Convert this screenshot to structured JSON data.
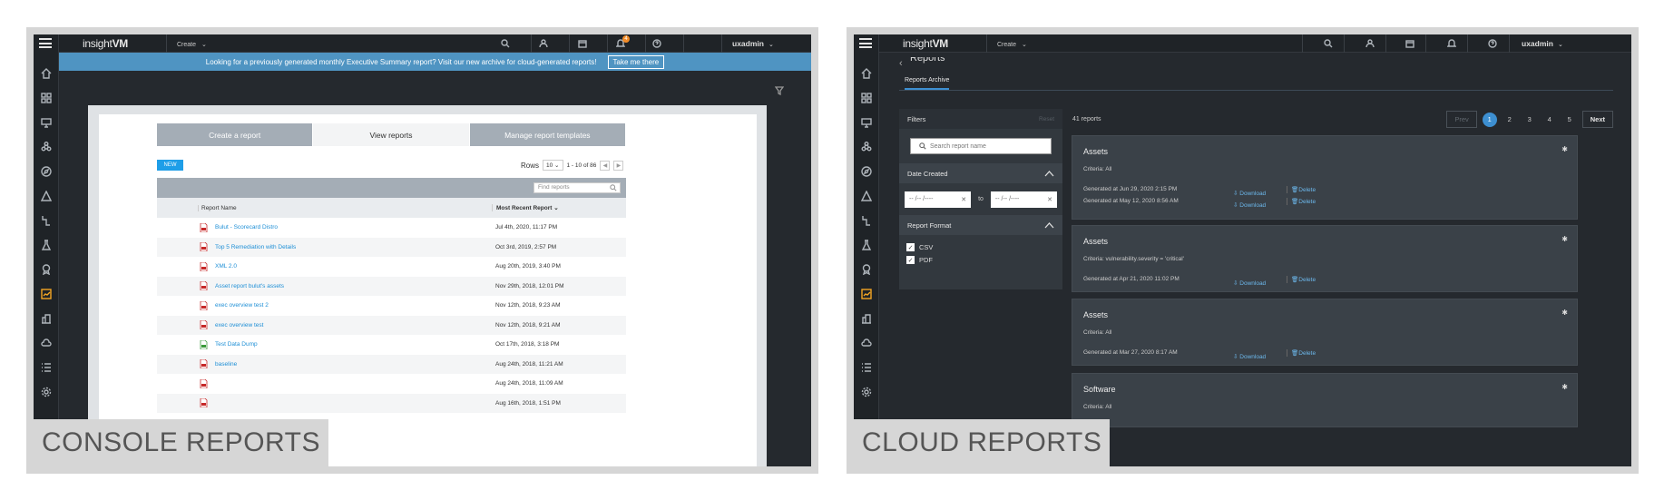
{
  "console": {
    "label": "CONSOLE REPORTS",
    "topbar": {
      "logo": "insightVM",
      "create": "Create",
      "user": "uxadmin",
      "notifications": "4"
    },
    "banner": {
      "text": "Looking for a previously generated monthly Executive Summary report? Visit our new archive for cloud-generated reports!",
      "button": "Take me there"
    },
    "tabs": [
      "Create a report",
      "View reports",
      "Manage report templates"
    ],
    "new_label": "NEW",
    "rows_label": "Rows",
    "rows_value": "10",
    "pagination": "1 - 10 of 86",
    "find_placeholder": "Find reports",
    "columns": {
      "name": "Report Name",
      "recent": "Most Recent Report"
    },
    "reports": [
      {
        "name": "Bulut - Scorecard Distro",
        "date": "Jul 4th, 2020, 11:17 PM",
        "type": "pdf"
      },
      {
        "name": "Top 5 Remediation with Details",
        "date": "Oct 3rd, 2019, 2:57 PM",
        "type": "pdf"
      },
      {
        "name": "XML 2.0",
        "date": "Aug 20th, 2019, 3:40 PM",
        "type": "xml"
      },
      {
        "name": "Asset report bulut's assets",
        "date": "Nov 29th, 2018, 12:01 PM",
        "type": "pdf"
      },
      {
        "name": "exec overview test 2",
        "date": "Nov 12th, 2018, 9:23 AM",
        "type": "pdf"
      },
      {
        "name": "exec overview test",
        "date": "Nov 12th, 2018, 9:21 AM",
        "type": "pdf"
      },
      {
        "name": "Test Data Dump",
        "date": "Oct 17th, 2018, 3:18 PM",
        "type": "csv"
      },
      {
        "name": "baseline",
        "date": "Aug 24th, 2018, 11:21 AM",
        "type": "pdf"
      },
      {
        "name": "",
        "date": "Aug 24th, 2018, 11:09 AM",
        "type": "pdf"
      },
      {
        "name": "",
        "date": "Aug 16th, 2018, 1:51 PM",
        "type": "pdf"
      }
    ]
  },
  "cloud": {
    "label": "CLOUD REPORTS",
    "topbar": {
      "logo": "insightVM",
      "create": "Create",
      "user": "uxadmin"
    },
    "title": "Reports",
    "tab": "Reports Archive",
    "filters": {
      "title": "Filters",
      "reset": "Reset",
      "search_placeholder": "Search report name",
      "date_section": "Date Created",
      "date_from": "-- /-- /----",
      "date_to": "-- /-- /----",
      "to_label": "to",
      "format_section": "Report Format",
      "formats": [
        "CSV",
        "PDF"
      ]
    },
    "count": "41 reports",
    "pager": {
      "prev": "Prev",
      "pages": [
        "1",
        "2",
        "3",
        "4",
        "5"
      ],
      "next": "Next"
    },
    "download_label": "Download",
    "delete_label": "Delete",
    "cards": [
      {
        "title": "Assets",
        "criteria": "Criteria: All",
        "generated": [
          "Generated at Jun 29, 2020 2:15 PM",
          "Generated at May 12, 2020 8:56 AM"
        ]
      },
      {
        "title": "Assets",
        "criteria": "Criteria: vulnerability.severity = 'critical'",
        "generated": [
          "Generated at Apr 21, 2020 11:02 PM"
        ]
      },
      {
        "title": "Assets",
        "criteria": "Criteria: All",
        "generated": [
          "Generated at Mar 27, 2020 8:17 AM"
        ]
      },
      {
        "title": "Software",
        "criteria": "Criteria: All",
        "generated": []
      }
    ]
  }
}
